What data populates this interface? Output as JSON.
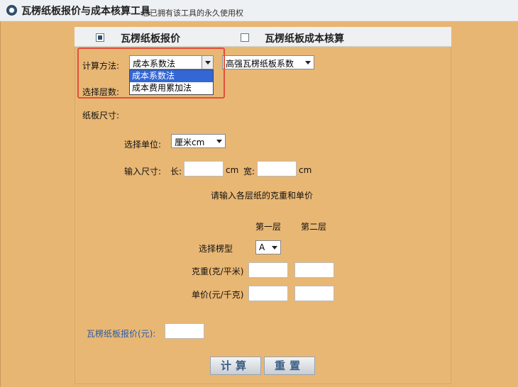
{
  "window": {
    "title": "瓦楞纸板报价与成本核算工具",
    "subtitle": "您已拥有该工具的永久使用权"
  },
  "tabs": [
    {
      "label": "瓦楞纸板报价",
      "checked": true
    },
    {
      "label": "瓦楞纸板成本核算",
      "checked": false
    }
  ],
  "calc_method": {
    "label": "计算方法:",
    "selected": "成本系数法",
    "options": [
      "成本系数法",
      "成本费用累加法"
    ]
  },
  "coef_select": {
    "selected": "高强瓦楞纸板系数"
  },
  "layers": {
    "label": "选择层数:"
  },
  "board_size": {
    "label": "纸板尺寸:"
  },
  "unit": {
    "label": "选择单位:",
    "selected": "厘米cm"
  },
  "size_input": {
    "label": "输入尺寸:",
    "length_label": "长:",
    "length_unit": "cm",
    "width_label": "宽:",
    "width_unit": "cm"
  },
  "paper_prompt": "请输入各层纸的克重和单价",
  "layer_headers": [
    "第一层",
    "第二层"
  ],
  "flute": {
    "label": "选择楞型",
    "selected": "A"
  },
  "gram_label": "克重(克/平米)",
  "price_label": "单价(元/千克)",
  "result_label": "瓦楞纸板报价(元):",
  "buttons": {
    "calc": "计算",
    "reset": "重置"
  },
  "colors": {
    "background": "#e8b673",
    "highlight": "#e0503a",
    "selected_option": "#3367d6"
  }
}
